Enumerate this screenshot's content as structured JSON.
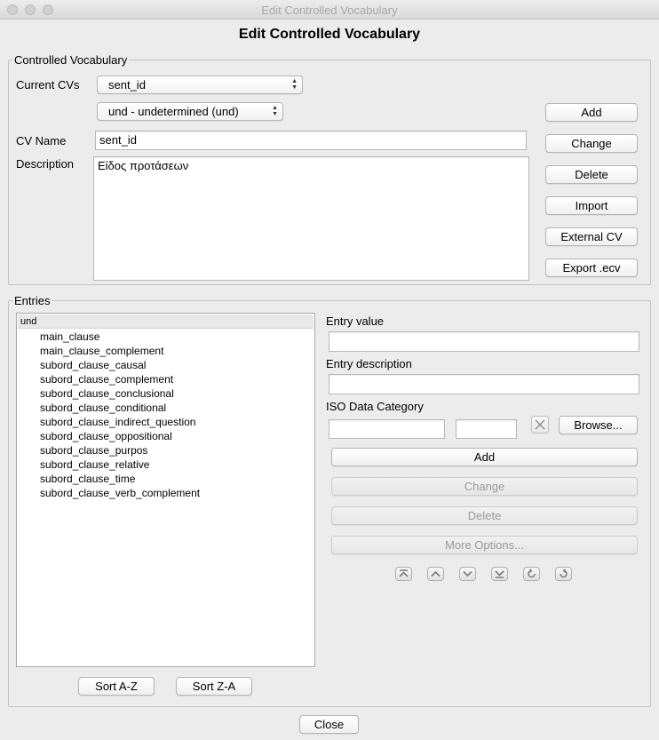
{
  "window": {
    "title": "Edit Controlled Vocabulary"
  },
  "dialog": {
    "heading": "Edit Controlled Vocabulary"
  },
  "cv_group": {
    "legend": "Controlled Vocabulary",
    "current_cvs_label": "Current CVs",
    "current_cv_value": "sent_id",
    "language_value": "und - undetermined (und)",
    "cv_name_label": "CV Name",
    "cv_name_value": "sent_id",
    "description_label": "Description",
    "description_value": "Είδος προτάσεων",
    "buttons": {
      "add": "Add",
      "change": "Change",
      "delete": "Delete",
      "import": "Import",
      "external_cv": "External CV",
      "export_ecv": "Export .ecv"
    }
  },
  "entries_group": {
    "legend": "Entries",
    "list_header": "und",
    "items": [
      "main_clause",
      "main_clause_complement",
      "subord_clause_causal",
      "subord_clause_complement",
      "subord_clause_conclusional",
      "subord_clause_conditional",
      "subord_clause_indirect_question",
      "subord_clause_oppositional",
      "subord_clause_purpos",
      "subord_clause_relative",
      "subord_clause_time",
      "subord_clause_verb_complement"
    ],
    "entry_value_label": "Entry value",
    "entry_value": "",
    "entry_description_label": "Entry description",
    "entry_description": "",
    "iso_label": "ISO Data Category",
    "iso_value_1": "",
    "iso_value_2": "",
    "browse_label": "Browse...",
    "add_label": "Add",
    "change_label": "Change",
    "delete_label": "Delete",
    "more_options_label": "More Options...",
    "sort_az_label": "Sort A-Z",
    "sort_za_label": "Sort Z-A",
    "nav_icons": [
      "move-to-top-icon",
      "move-up-icon",
      "move-down-icon",
      "move-to-bottom-icon",
      "undo-icon",
      "redo-icon"
    ]
  },
  "footer": {
    "close_label": "Close"
  },
  "colors": {
    "window_bg": "#ececec",
    "disabled_text": "#9a9a9a",
    "group_border": "#c4c4c4"
  }
}
